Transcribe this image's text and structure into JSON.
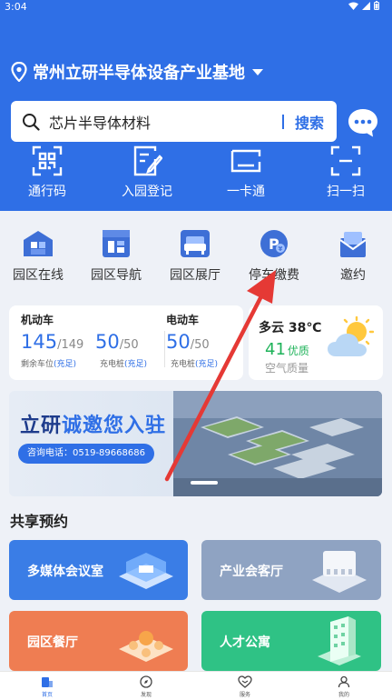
{
  "status_bar": {
    "time": "3:04"
  },
  "location": {
    "name": "常州立研半导体设备产业基地"
  },
  "search": {
    "value": "芯片半导体材料",
    "button": "搜索"
  },
  "quick_actions": [
    {
      "label": "通行码",
      "icon": "qr-code-icon"
    },
    {
      "label": "入园登记",
      "icon": "register-icon"
    },
    {
      "label": "一卡通",
      "icon": "card-icon"
    },
    {
      "label": "扫一扫",
      "icon": "scan-icon"
    }
  ],
  "services": [
    {
      "label": "园区在线",
      "icon": "park-online-icon"
    },
    {
      "label": "园区导航",
      "icon": "park-nav-icon"
    },
    {
      "label": "园区展厅",
      "icon": "showroom-icon"
    },
    {
      "label": "停车缴费",
      "icon": "parking-pay-icon"
    },
    {
      "label": "邀约",
      "icon": "invite-icon"
    }
  ],
  "parking": {
    "motor_label": "机动车",
    "ev_label": "电动车",
    "motor_spaces": "145",
    "motor_total": "/149",
    "motor_spaces_label": "剩余车位",
    "motor_spaces_status": "(充足)",
    "motor_chargers": "50",
    "motor_chargers_total": "/50",
    "motor_chargers_label": "充电桩",
    "motor_chargers_status": "(充足)",
    "ev_chargers": "50",
    "ev_chargers_total": "/50",
    "ev_chargers_label": "充电桩",
    "ev_chargers_status": "(充足)"
  },
  "weather": {
    "condition": "多云 38℃",
    "aqi": "41",
    "aqi_level": "优质",
    "aqi_label": "空气质量"
  },
  "banner": {
    "title_prefix": "立研",
    "title_highlight": "诚邀您入驻",
    "phone": "咨询电话：0519-89668686"
  },
  "shared_booking": {
    "title": "共享预约",
    "tiles": [
      {
        "label": "多媒体会议室",
        "color": "#3a7de6"
      },
      {
        "label": "产业会客厅",
        "color": "#8fa3c2"
      },
      {
        "label": "园区餐厅",
        "color": "#ef7d52"
      },
      {
        "label": "人才公寓",
        "color": "#2fc285"
      }
    ]
  },
  "tabbar": [
    {
      "label": "首页",
      "active": true
    },
    {
      "label": "发现",
      "active": false
    },
    {
      "label": "服务",
      "active": false
    },
    {
      "label": "我的",
      "active": false
    }
  ],
  "colors": {
    "primary": "#2f6fe6",
    "annotation": "#e53935",
    "good": "#1fb35a"
  }
}
